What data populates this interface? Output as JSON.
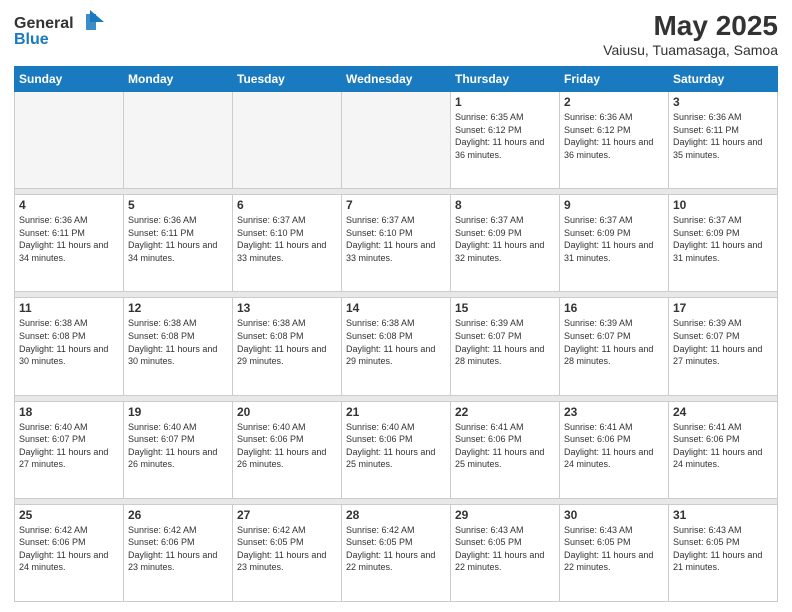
{
  "header": {
    "logo_line1": "General",
    "logo_line2": "Blue",
    "month": "May 2025",
    "location": "Vaiusu, Tuamasaga, Samoa"
  },
  "days_of_week": [
    "Sunday",
    "Monday",
    "Tuesday",
    "Wednesday",
    "Thursday",
    "Friday",
    "Saturday"
  ],
  "weeks": [
    [
      {
        "day": "",
        "empty": true
      },
      {
        "day": "",
        "empty": true
      },
      {
        "day": "",
        "empty": true
      },
      {
        "day": "",
        "empty": true
      },
      {
        "day": "1",
        "sunrise": "6:35 AM",
        "sunset": "6:12 PM",
        "daylight": "11 hours and 36 minutes."
      },
      {
        "day": "2",
        "sunrise": "6:36 AM",
        "sunset": "6:12 PM",
        "daylight": "11 hours and 36 minutes."
      },
      {
        "day": "3",
        "sunrise": "6:36 AM",
        "sunset": "6:11 PM",
        "daylight": "11 hours and 35 minutes."
      }
    ],
    [
      {
        "day": "4",
        "sunrise": "6:36 AM",
        "sunset": "6:11 PM",
        "daylight": "11 hours and 34 minutes."
      },
      {
        "day": "5",
        "sunrise": "6:36 AM",
        "sunset": "6:11 PM",
        "daylight": "11 hours and 34 minutes."
      },
      {
        "day": "6",
        "sunrise": "6:37 AM",
        "sunset": "6:10 PM",
        "daylight": "11 hours and 33 minutes."
      },
      {
        "day": "7",
        "sunrise": "6:37 AM",
        "sunset": "6:10 PM",
        "daylight": "11 hours and 33 minutes."
      },
      {
        "day": "8",
        "sunrise": "6:37 AM",
        "sunset": "6:09 PM",
        "daylight": "11 hours and 32 minutes."
      },
      {
        "day": "9",
        "sunrise": "6:37 AM",
        "sunset": "6:09 PM",
        "daylight": "11 hours and 31 minutes."
      },
      {
        "day": "10",
        "sunrise": "6:37 AM",
        "sunset": "6:09 PM",
        "daylight": "11 hours and 31 minutes."
      }
    ],
    [
      {
        "day": "11",
        "sunrise": "6:38 AM",
        "sunset": "6:08 PM",
        "daylight": "11 hours and 30 minutes."
      },
      {
        "day": "12",
        "sunrise": "6:38 AM",
        "sunset": "6:08 PM",
        "daylight": "11 hours and 30 minutes."
      },
      {
        "day": "13",
        "sunrise": "6:38 AM",
        "sunset": "6:08 PM",
        "daylight": "11 hours and 29 minutes."
      },
      {
        "day": "14",
        "sunrise": "6:38 AM",
        "sunset": "6:08 PM",
        "daylight": "11 hours and 29 minutes."
      },
      {
        "day": "15",
        "sunrise": "6:39 AM",
        "sunset": "6:07 PM",
        "daylight": "11 hours and 28 minutes."
      },
      {
        "day": "16",
        "sunrise": "6:39 AM",
        "sunset": "6:07 PM",
        "daylight": "11 hours and 28 minutes."
      },
      {
        "day": "17",
        "sunrise": "6:39 AM",
        "sunset": "6:07 PM",
        "daylight": "11 hours and 27 minutes."
      }
    ],
    [
      {
        "day": "18",
        "sunrise": "6:40 AM",
        "sunset": "6:07 PM",
        "daylight": "11 hours and 27 minutes."
      },
      {
        "day": "19",
        "sunrise": "6:40 AM",
        "sunset": "6:07 PM",
        "daylight": "11 hours and 26 minutes."
      },
      {
        "day": "20",
        "sunrise": "6:40 AM",
        "sunset": "6:06 PM",
        "daylight": "11 hours and 26 minutes."
      },
      {
        "day": "21",
        "sunrise": "6:40 AM",
        "sunset": "6:06 PM",
        "daylight": "11 hours and 25 minutes."
      },
      {
        "day": "22",
        "sunrise": "6:41 AM",
        "sunset": "6:06 PM",
        "daylight": "11 hours and 25 minutes."
      },
      {
        "day": "23",
        "sunrise": "6:41 AM",
        "sunset": "6:06 PM",
        "daylight": "11 hours and 24 minutes."
      },
      {
        "day": "24",
        "sunrise": "6:41 AM",
        "sunset": "6:06 PM",
        "daylight": "11 hours and 24 minutes."
      }
    ],
    [
      {
        "day": "25",
        "sunrise": "6:42 AM",
        "sunset": "6:06 PM",
        "daylight": "11 hours and 24 minutes."
      },
      {
        "day": "26",
        "sunrise": "6:42 AM",
        "sunset": "6:06 PM",
        "daylight": "11 hours and 23 minutes."
      },
      {
        "day": "27",
        "sunrise": "6:42 AM",
        "sunset": "6:05 PM",
        "daylight": "11 hours and 23 minutes."
      },
      {
        "day": "28",
        "sunrise": "6:42 AM",
        "sunset": "6:05 PM",
        "daylight": "11 hours and 22 minutes."
      },
      {
        "day": "29",
        "sunrise": "6:43 AM",
        "sunset": "6:05 PM",
        "daylight": "11 hours and 22 minutes."
      },
      {
        "day": "30",
        "sunrise": "6:43 AM",
        "sunset": "6:05 PM",
        "daylight": "11 hours and 22 minutes."
      },
      {
        "day": "31",
        "sunrise": "6:43 AM",
        "sunset": "6:05 PM",
        "daylight": "11 hours and 21 minutes."
      }
    ]
  ],
  "labels": {
    "sunrise": "Sunrise:",
    "sunset": "Sunset:",
    "daylight": "Daylight:"
  }
}
